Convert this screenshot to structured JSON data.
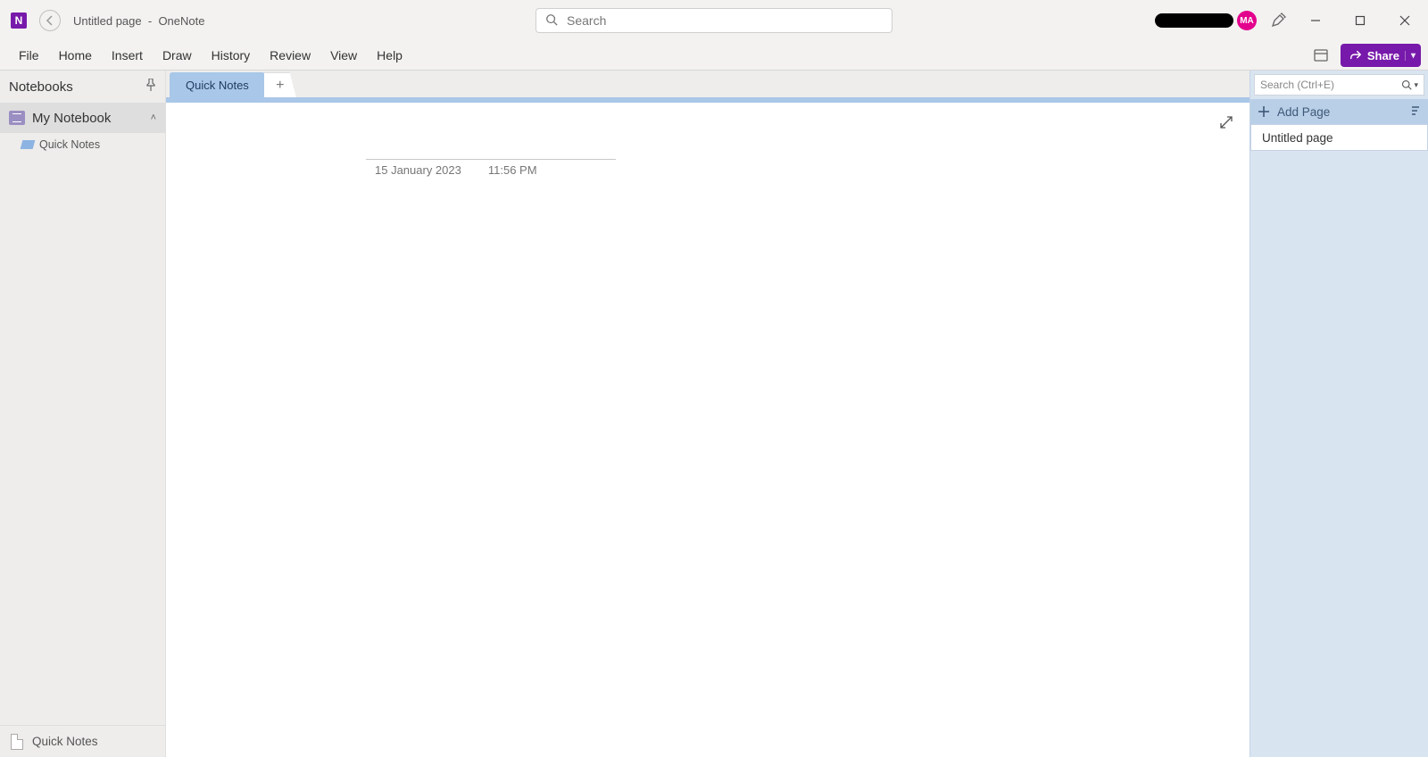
{
  "titlebar": {
    "app_glyph": "N",
    "title_page": "Untitled page",
    "title_sep": "-",
    "app_name": "OneNote",
    "search_placeholder": "Search",
    "avatar_initials": "MA"
  },
  "menu": {
    "items": [
      "File",
      "Home",
      "Insert",
      "Draw",
      "History",
      "Review",
      "View",
      "Help"
    ],
    "share_label": "Share"
  },
  "sidebar": {
    "header": "Notebooks",
    "notebook": "My Notebook",
    "section": "Quick Notes",
    "footer": "Quick Notes"
  },
  "tabs": {
    "active": "Quick Notes"
  },
  "page_meta": {
    "date": "15 January 2023",
    "time": "11:56 PM"
  },
  "right": {
    "search_placeholder": "Search (Ctrl+E)",
    "add_page": "Add Page",
    "pages": [
      "Untitled page"
    ]
  }
}
